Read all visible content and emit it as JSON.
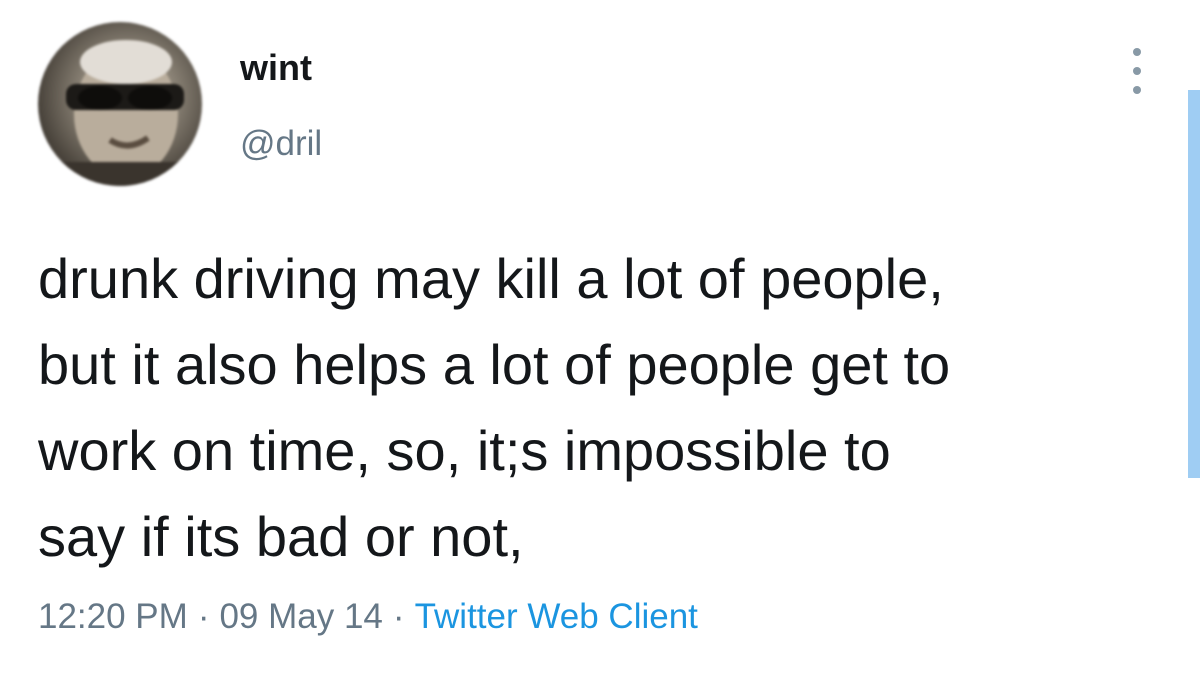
{
  "author": {
    "display_name": "wint",
    "handle": "@dril"
  },
  "tweet": {
    "lines": [
      "drunk driving may kill a lot of people,",
      "but it also helps a lot of people get to",
      "work on time, so, it;s impossible to",
      "say if its bad or not,"
    ]
  },
  "meta": {
    "time": "12:20 PM",
    "separator": "·",
    "date": "09 May 14",
    "source": "Twitter Web Client"
  },
  "icons": {
    "more": "more-vertical-icon",
    "avatar": "profile-photo"
  },
  "colors": {
    "text": "#14171a",
    "secondary": "#657786",
    "link": "#1b95e0",
    "scroll_indicator": "#9fcdf3"
  }
}
